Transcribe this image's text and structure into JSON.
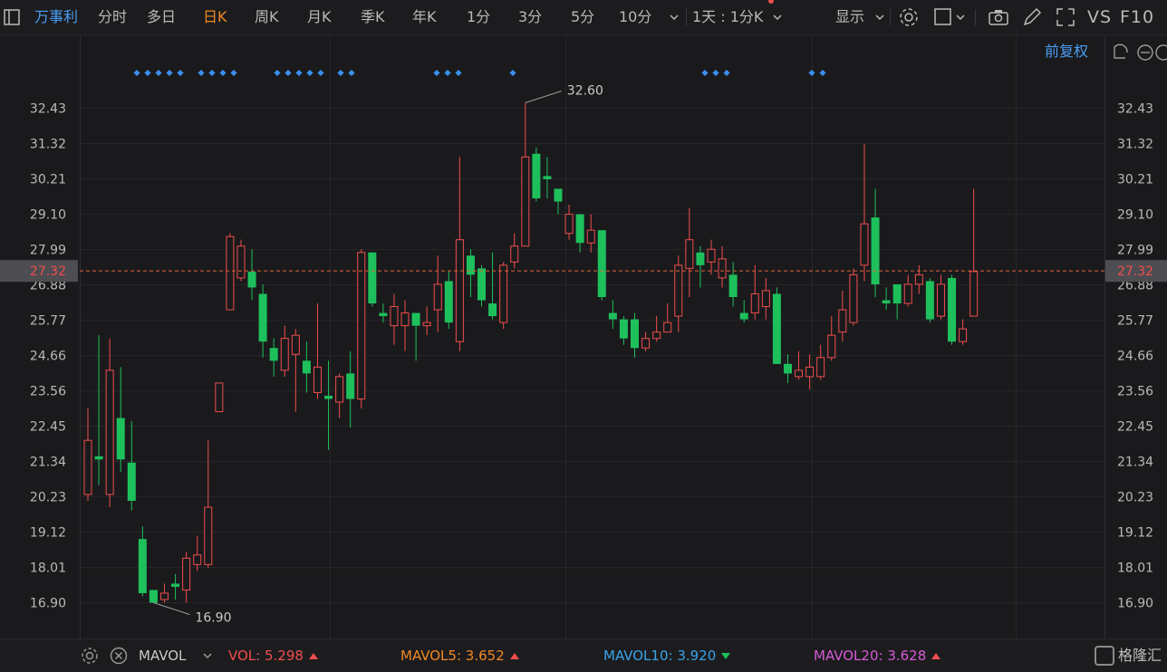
{
  "toolbar": {
    "stock_name": "万事利",
    "tabs": [
      {
        "label": "分时",
        "active": false
      },
      {
        "label": "多日",
        "active": false
      },
      {
        "label": "日K",
        "active": true
      },
      {
        "label": "周K",
        "active": false
      },
      {
        "label": "月K",
        "active": false
      },
      {
        "label": "季K",
        "active": false
      },
      {
        "label": "年K",
        "active": false
      },
      {
        "label": "1分",
        "active": false
      },
      {
        "label": "3分",
        "active": false
      },
      {
        "label": "5分",
        "active": false
      },
      {
        "label": "10分",
        "active": false
      }
    ],
    "period_select": "1天 : 1分K",
    "display_label": "显示",
    "vs_label": "VS",
    "f10_label": "F10",
    "adjust_label": "前复权"
  },
  "colors": {
    "up": "#ef4d4d",
    "down": "#1ec05c",
    "accent": "#f08a24",
    "link": "#4a9ef5",
    "current_price_bg": "#4d4d52",
    "vol": "#ef4d4d",
    "mavol5": "#f08a24",
    "mavol10": "#3aa3e8",
    "mavol20": "#d65ad6"
  },
  "chart_data": {
    "type": "candlestick",
    "y_ticks": [
      "32.43",
      "31.32",
      "30.21",
      "29.10",
      "27.99",
      "26.88",
      "25.77",
      "24.66",
      "23.56",
      "22.45",
      "21.34",
      "20.23",
      "19.12",
      "18.01",
      "16.90"
    ],
    "ylim": [
      16.9,
      32.43
    ],
    "current_price": "27.32",
    "annotations": [
      {
        "label": "32.60",
        "value": 32.6
      },
      {
        "label": "16.90",
        "value": 16.9
      }
    ],
    "candles": [
      {
        "o": 20.3,
        "c": 22.0,
        "h": 23.0,
        "l": 20.1
      },
      {
        "o": 21.5,
        "c": 21.4,
        "h": 25.3,
        "l": 20.6
      },
      {
        "o": 20.3,
        "c": 24.2,
        "h": 25.2,
        "l": 19.9
      },
      {
        "o": 22.7,
        "c": 21.4,
        "h": 24.3,
        "l": 21.0
      },
      {
        "o": 21.3,
        "c": 20.1,
        "h": 22.6,
        "l": 19.8
      },
      {
        "o": 18.9,
        "c": 17.2,
        "h": 19.3,
        "l": 17.1
      },
      {
        "o": 17.3,
        "c": 16.9,
        "h": 17.1,
        "l": 16.9
      },
      {
        "o": 17.0,
        "c": 17.2,
        "h": 17.5,
        "l": 16.9
      },
      {
        "o": 17.5,
        "c": 17.4,
        "h": 17.8,
        "l": 17.0
      },
      {
        "o": 17.3,
        "c": 18.3,
        "h": 18.5,
        "l": 16.9
      },
      {
        "o": 18.1,
        "c": 18.4,
        "h": 19.0,
        "l": 17.9
      },
      {
        "o": 18.1,
        "c": 19.9,
        "h": 22.0,
        "l": 18.0
      },
      {
        "o": 22.9,
        "c": 23.8,
        "h": 23.8,
        "l": 22.9
      },
      {
        "o": 26.1,
        "c": 28.4,
        "h": 28.5,
        "l": 26.1
      },
      {
        "o": 27.1,
        "c": 28.1,
        "h": 28.3,
        "l": 27.0
      },
      {
        "o": 27.3,
        "c": 26.8,
        "h": 28.0,
        "l": 26.4
      },
      {
        "o": 26.6,
        "c": 25.1,
        "h": 26.9,
        "l": 24.6
      },
      {
        "o": 24.9,
        "c": 24.5,
        "h": 25.2,
        "l": 24.0
      },
      {
        "o": 24.2,
        "c": 25.2,
        "h": 25.6,
        "l": 24.0
      },
      {
        "o": 24.7,
        "c": 25.3,
        "h": 25.5,
        "l": 22.9
      },
      {
        "o": 24.5,
        "c": 24.1,
        "h": 25.1,
        "l": 23.5
      },
      {
        "o": 23.5,
        "c": 24.3,
        "h": 26.3,
        "l": 23.3
      },
      {
        "o": 23.4,
        "c": 23.3,
        "h": 24.5,
        "l": 21.7
      },
      {
        "o": 23.2,
        "c": 24.0,
        "h": 24.1,
        "l": 22.7
      },
      {
        "o": 24.1,
        "c": 23.3,
        "h": 24.8,
        "l": 22.4
      },
      {
        "o": 23.3,
        "c": 27.9,
        "h": 28.0,
        "l": 23.0
      },
      {
        "o": 27.9,
        "c": 26.3,
        "h": 27.9,
        "l": 26.2
      },
      {
        "o": 26.0,
        "c": 25.9,
        "h": 26.3,
        "l": 25.7
      },
      {
        "o": 25.6,
        "c": 26.2,
        "h": 26.6,
        "l": 25.0
      },
      {
        "o": 25.6,
        "c": 26.0,
        "h": 26.4,
        "l": 24.8
      },
      {
        "o": 26.0,
        "c": 25.6,
        "h": 26.0,
        "l": 24.5
      },
      {
        "o": 25.6,
        "c": 25.7,
        "h": 26.2,
        "l": 25.3
      },
      {
        "o": 26.1,
        "c": 26.9,
        "h": 27.8,
        "l": 25.4
      },
      {
        "o": 27.0,
        "c": 25.7,
        "h": 27.3,
        "l": 25.5
      },
      {
        "o": 25.1,
        "c": 28.3,
        "h": 30.9,
        "l": 24.8
      },
      {
        "o": 27.8,
        "c": 27.2,
        "h": 28.0,
        "l": 26.5
      },
      {
        "o": 27.4,
        "c": 26.4,
        "h": 27.5,
        "l": 26.2
      },
      {
        "o": 26.3,
        "c": 25.9,
        "h": 27.9,
        "l": 25.8
      },
      {
        "o": 25.7,
        "c": 27.5,
        "h": 27.6,
        "l": 25.5
      },
      {
        "o": 27.6,
        "c": 28.1,
        "h": 28.5,
        "l": 27.4
      },
      {
        "o": 28.1,
        "c": 30.9,
        "h": 32.6,
        "l": 28.1
      },
      {
        "o": 31.0,
        "c": 29.6,
        "h": 31.2,
        "l": 29.5
      },
      {
        "o": 30.3,
        "c": 30.2,
        "h": 30.9,
        "l": 29.6
      },
      {
        "o": 29.9,
        "c": 29.5,
        "h": 29.9,
        "l": 29.1
      },
      {
        "o": 28.5,
        "c": 29.1,
        "h": 29.4,
        "l": 28.3
      },
      {
        "o": 29.1,
        "c": 28.2,
        "h": 29.1,
        "l": 27.9
      },
      {
        "o": 28.2,
        "c": 28.6,
        "h": 29.1,
        "l": 27.9
      },
      {
        "o": 28.6,
        "c": 26.5,
        "h": 28.6,
        "l": 26.4
      },
      {
        "o": 26.0,
        "c": 25.8,
        "h": 26.4,
        "l": 25.5
      },
      {
        "o": 25.8,
        "c": 25.2,
        "h": 25.9,
        "l": 25.0
      },
      {
        "o": 25.8,
        "c": 24.9,
        "h": 26.0,
        "l": 24.6
      },
      {
        "o": 24.9,
        "c": 25.2,
        "h": 25.4,
        "l": 24.8
      },
      {
        "o": 25.2,
        "c": 25.4,
        "h": 25.9,
        "l": 25.1
      },
      {
        "o": 25.4,
        "c": 25.7,
        "h": 26.3,
        "l": 25.4
      },
      {
        "o": 25.9,
        "c": 27.5,
        "h": 27.8,
        "l": 25.4
      },
      {
        "o": 27.4,
        "c": 28.3,
        "h": 29.3,
        "l": 26.5
      },
      {
        "o": 27.9,
        "c": 27.5,
        "h": 28.1,
        "l": 26.8
      },
      {
        "o": 27.6,
        "c": 28.0,
        "h": 28.3,
        "l": 27.2
      },
      {
        "o": 27.1,
        "c": 27.7,
        "h": 28.1,
        "l": 26.8
      },
      {
        "o": 27.2,
        "c": 26.5,
        "h": 27.6,
        "l": 26.2
      },
      {
        "o": 26.0,
        "c": 25.8,
        "h": 26.4,
        "l": 25.7
      },
      {
        "o": 26.0,
        "c": 26.6,
        "h": 27.5,
        "l": 25.8
      },
      {
        "o": 26.2,
        "c": 26.7,
        "h": 27.1,
        "l": 25.8
      },
      {
        "o": 26.6,
        "c": 24.4,
        "h": 26.8,
        "l": 24.4
      },
      {
        "o": 24.4,
        "c": 24.1,
        "h": 24.7,
        "l": 23.8
      },
      {
        "o": 24.0,
        "c": 24.2,
        "h": 24.8,
        "l": 23.9
      },
      {
        "o": 24.0,
        "c": 24.3,
        "h": 24.7,
        "l": 23.6
      },
      {
        "o": 24.0,
        "c": 24.6,
        "h": 25.0,
        "l": 23.9
      },
      {
        "o": 24.6,
        "c": 25.3,
        "h": 25.9,
        "l": 24.5
      },
      {
        "o": 25.4,
        "c": 26.1,
        "h": 26.7,
        "l": 25.1
      },
      {
        "o": 25.7,
        "c": 27.2,
        "h": 27.4,
        "l": 25.6
      },
      {
        "o": 27.5,
        "c": 28.8,
        "h": 31.3,
        "l": 27.0
      },
      {
        "o": 29.0,
        "c": 26.9,
        "h": 29.9,
        "l": 26.5
      },
      {
        "o": 26.4,
        "c": 26.3,
        "h": 26.8,
        "l": 26.1
      },
      {
        "o": 26.9,
        "c": 26.3,
        "h": 26.9,
        "l": 25.8
      },
      {
        "o": 26.3,
        "c": 26.9,
        "h": 27.2,
        "l": 26.2
      },
      {
        "o": 26.9,
        "c": 27.2,
        "h": 27.5,
        "l": 26.6
      },
      {
        "o": 27.0,
        "c": 25.8,
        "h": 27.1,
        "l": 25.7
      },
      {
        "o": 25.9,
        "c": 26.9,
        "h": 27.2,
        "l": 25.8
      },
      {
        "o": 27.1,
        "c": 25.1,
        "h": 27.2,
        "l": 25.0
      },
      {
        "o": 25.1,
        "c": 25.5,
        "h": 25.8,
        "l": 25.0
      },
      {
        "o": 25.9,
        "c": 27.3,
        "h": 29.9,
        "l": 25.9
      }
    ]
  },
  "footer": {
    "indicator_name": "MAVOL",
    "vol_label": "VOL:",
    "vol_value": "5.298",
    "mavol5_label": "MAVOL5:",
    "mavol5_value": "3.652",
    "mavol10_label": "MAVOL10:",
    "mavol10_value": "3.920",
    "mavol20_label": "MAVOL20:",
    "mavol20_value": "3.628",
    "brand": "格隆汇"
  }
}
